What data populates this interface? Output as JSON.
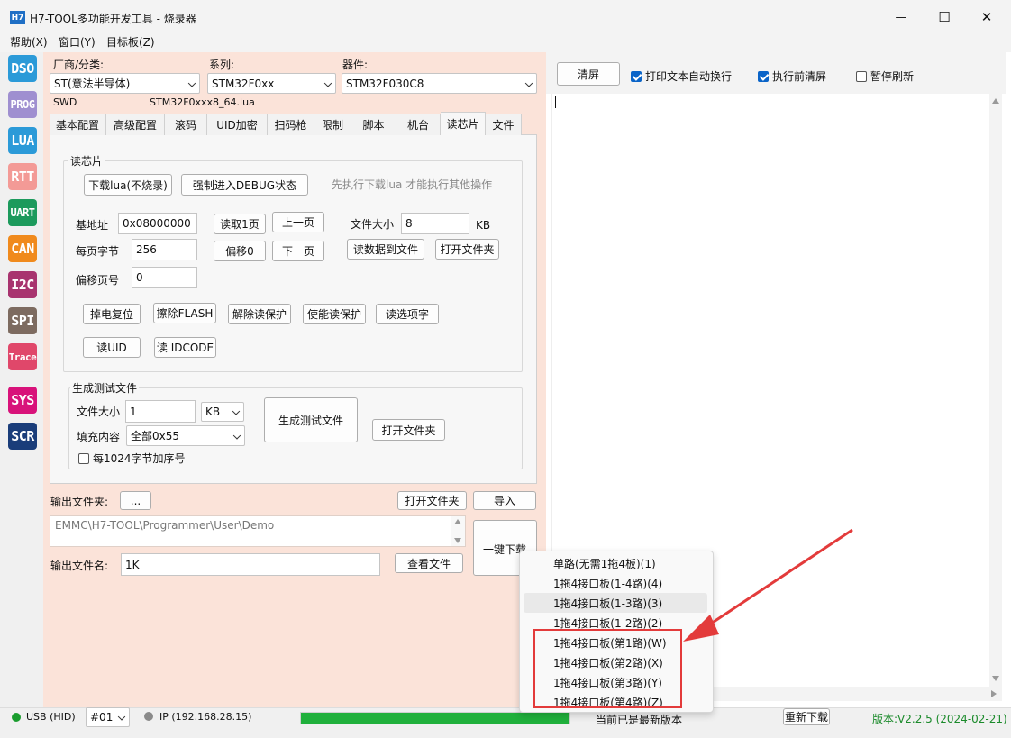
{
  "window": {
    "app_icon_text": "H7",
    "title": "H7-TOOL多功能开发工具 - 烧录器",
    "minimize": "—",
    "maximize": "☐",
    "close": "✕"
  },
  "menu": [
    "帮助(X)",
    "窗口(Y)",
    "目标板(Z)"
  ],
  "sidebar": [
    "DSO",
    "PROG",
    "LUA",
    "RTT",
    "UART",
    "CAN",
    "I2C",
    "SPI",
    "Trace",
    "SYS",
    "SCR"
  ],
  "sidebar_colors": [
    "#2b9ad8",
    "#9f8fd0",
    "#2b9ad8",
    "#f39a96",
    "#1c9a5c",
    "#f08a1c",
    "#a8346f",
    "#7d6b60",
    "#e0476a",
    "#d8127a",
    "#1a3d7a"
  ],
  "device": {
    "vendor_label": "厂商/分类:",
    "vendor_value": "ST(意法半导体)",
    "series_label": "系列:",
    "series_value": "STM32F0xx",
    "part_label": "器件:",
    "part_value": "STM32F030C8",
    "interface": "SWD",
    "lua_file": "STM32F0xxx8_64.lua"
  },
  "tabs": [
    "基本配置",
    "高级配置",
    "滚码",
    "UID加密",
    "扫码枪",
    "限制",
    "脚本",
    "机台",
    "读芯片",
    "文件"
  ],
  "read_chip": {
    "group_title": "读芯片",
    "download_lua": "下载lua(不烧录)",
    "force_debug": "强制进入DEBUG状态",
    "hint": "先执行下载lua 才能执行其他操作",
    "base_addr_label": "基地址",
    "base_addr_value": "0x08000000",
    "read_page": "读取1页",
    "prev_page": "上一页",
    "file_size_label": "文件大小",
    "file_size_value": "8",
    "file_size_unit": "KB",
    "bytes_per_page_label": "每页字节",
    "bytes_per_page_value": "256",
    "offset0": "偏移0",
    "next_page": "下一页",
    "read_to_file": "读数据到文件",
    "open_folder": "打开文件夹",
    "offset_page_label": "偏移页号",
    "offset_page_value": "0",
    "power_reset": "掉电复位",
    "erase_flash": "擦除FLASH",
    "unprotect": "解除读保护",
    "protect": "使能读保护",
    "read_option": "读选项字",
    "read_uid": "读UID",
    "read_idcode": "读 IDCODE"
  },
  "test_file": {
    "group_title": "生成测试文件",
    "size_label": "文件大小",
    "size_value": "1",
    "unit_value": "KB",
    "fill_label": "填充内容",
    "fill_value": "全部0x55",
    "seq_label": "每1024字节加序号",
    "generate": "生成测试文件",
    "open_folder": "打开文件夹"
  },
  "output": {
    "folder_label": "输出文件夹:",
    "browse": "...",
    "open_folder": "打开文件夹",
    "import": "导入",
    "path": "EMMC\\H7-TOOL\\Programmer\\User\\Demo",
    "name_label": "输出文件名:",
    "name_value": "1K",
    "view_file": "查看文件",
    "one_key": "一键下载"
  },
  "dropdown": [
    "单路(无需1拖4板)(1)",
    "1拖4接口板(1-4路)(4)",
    "1拖4接口板(1-3路)(3)",
    "1拖4接口板(1-2路)(2)",
    "1拖4接口板(第1路)(W)",
    "1拖4接口板(第2路)(X)",
    "1拖4接口板(第3路)(Y)",
    "1拖4接口板(第4路)(Z)"
  ],
  "console": {
    "clear": "清屏",
    "auto_wrap": "打印文本自动换行",
    "clear_before": "执行前清屏",
    "pause_refresh": "暂停刷新"
  },
  "status": {
    "usb": "USB (HID)",
    "device_no": "#01",
    "ip": "IP (192.168.28.15)",
    "progress": 1.0,
    "latest": "当前已是最新版本",
    "redownload": "重新下载",
    "version": "版本:V2.2.5 (2024-02-21)"
  },
  "colors": {
    "panel_bg": "#fbe3d9",
    "accent": "#0a64c8",
    "annotation_red": "#e33b3b",
    "progress_green": "#20b03c",
    "version_green": "#1a8a2a"
  }
}
